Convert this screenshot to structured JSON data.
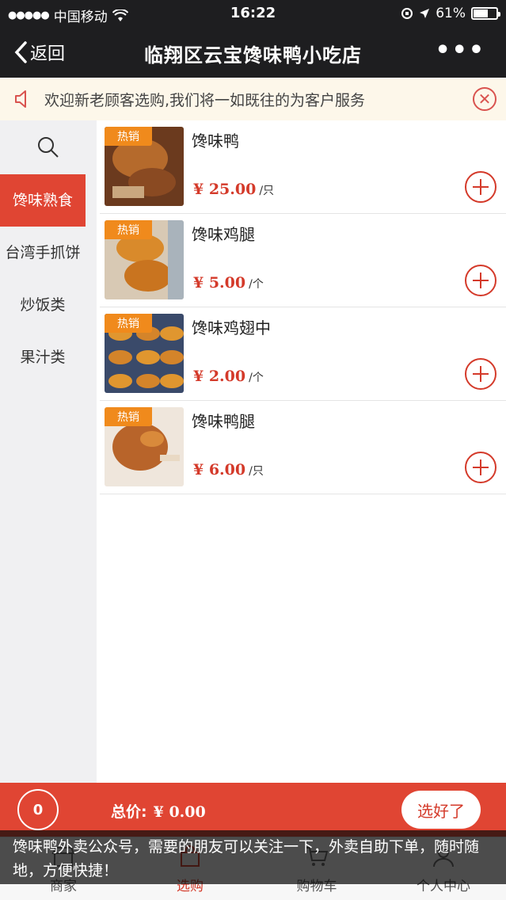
{
  "status_bar": {
    "carrier": "中国移动",
    "time": "16:22",
    "battery": "61%"
  },
  "nav": {
    "back_label": "返回",
    "title": "临翔区云宝馋味鸭小吃店"
  },
  "notice": {
    "text": "欢迎新老顾客选购,我们将一如既往的为客户服务"
  },
  "sidebar": {
    "categories": [
      {
        "label": "馋味熟食"
      },
      {
        "label": "台湾手抓饼"
      },
      {
        "label": "炒饭类"
      },
      {
        "label": "果汁类"
      }
    ]
  },
  "products": [
    {
      "badge": "热销",
      "name": "馋味鸭",
      "price": "¥ 25.00",
      "unit": "/只"
    },
    {
      "badge": "热销",
      "name": "馋味鸡腿",
      "price": "¥ 5.00",
      "unit": "/个"
    },
    {
      "badge": "热销",
      "name": "馋味鸡翅中",
      "price": "¥ 2.00",
      "unit": "/个"
    },
    {
      "badge": "热销",
      "name": "馋味鸭腿",
      "price": "¥ 6.00",
      "unit": "/只"
    }
  ],
  "cart": {
    "count": "0",
    "total_label": "总价:",
    "total_value": "¥ 0.00",
    "checkout_label": "选好了"
  },
  "tabs": [
    {
      "label": "商家",
      "icon": "store-icon"
    },
    {
      "label": "选购",
      "icon": "shopping-bag-icon"
    },
    {
      "label": "购物车",
      "icon": "cart-icon"
    },
    {
      "label": "个人中心",
      "icon": "person-icon"
    }
  ],
  "caption": {
    "text": "馋味鸭外卖公众号，需要的朋友可以关注一下，外卖自助下单，随时随地，方便快捷！"
  },
  "colors": {
    "accent": "#e04533",
    "badge": "#f08a1c",
    "price": "#d43a2a",
    "nav_bg": "#1e1e20"
  }
}
